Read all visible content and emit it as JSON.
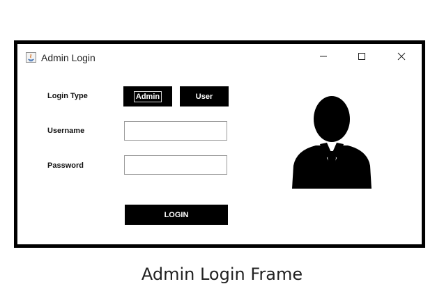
{
  "window": {
    "title": "Admin Login",
    "icon": "java-app-icon",
    "controls": [
      "minimize-icon",
      "maximize-icon",
      "close-icon"
    ]
  },
  "form": {
    "login_type_label": "Login Type",
    "login_types": [
      "Admin",
      "User"
    ],
    "selected_login_type": "Admin",
    "username_label": "Username",
    "username_value": "",
    "password_label": "Password",
    "password_value": "",
    "login_button": "LOGIN"
  },
  "avatar": {
    "icon": "user-avatar-icon"
  },
  "caption": "Admin Login Frame"
}
